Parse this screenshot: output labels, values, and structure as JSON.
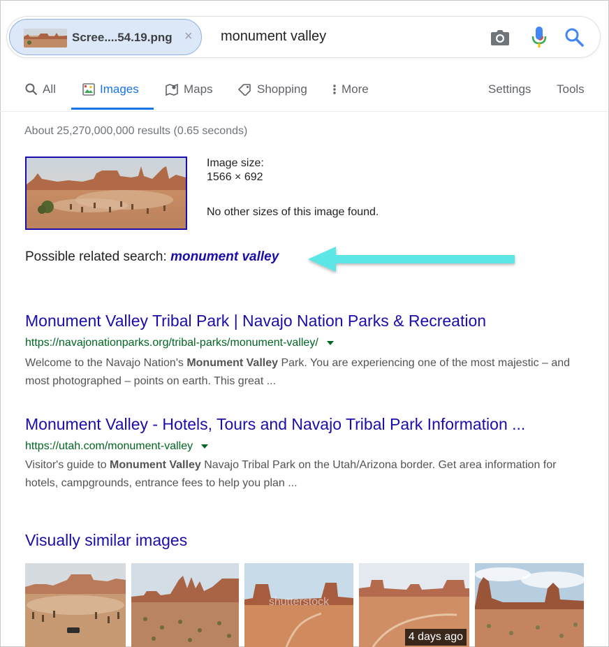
{
  "search": {
    "chip_label": "Scree....54.19.png",
    "chip_close": "×",
    "query": "monument valley",
    "icons": [
      "camera-icon",
      "microphone-icon",
      "search-icon"
    ]
  },
  "tabs": [
    {
      "label": "All",
      "icon": "search-icon"
    },
    {
      "label": "Images",
      "icon": "image-icon",
      "active": true
    },
    {
      "label": "Maps",
      "icon": "map-icon"
    },
    {
      "label": "Shopping",
      "icon": "tag-icon"
    },
    {
      "label": "More",
      "icon": "more-vert-icon"
    }
  ],
  "tools": {
    "settings": "Settings",
    "tools": "Tools"
  },
  "stats": "About 25,270,000,000 results (0.65 seconds)",
  "image_info": {
    "size_label": "Image size:",
    "size_value": "1566 × 692",
    "other_sizes": "No other sizes of this image found."
  },
  "related": {
    "prefix": "Possible related search:",
    "link": "monument valley"
  },
  "results": [
    {
      "title": "Monument Valley Tribal Park | Navajo Nation Parks & Recreation",
      "url": "https://navajonationparks.org/tribal-parks/monument-valley/",
      "snippet_1": "Welcome to the Navajo Nation's ",
      "snippet_bold": "Monument Valley",
      "snippet_2": " Park. You are experiencing one of the most majestic – and most photographed – points on earth. This great ..."
    },
    {
      "title": "Monument Valley - Hotels, Tours and Navajo Tribal Park Information ...",
      "url": "https://utah.com/monument-valley",
      "snippet_1": "Visitor's guide to ",
      "snippet_bold": "Monument Valley",
      "snippet_2": " Navajo Tribal Park on the Utah/Arizona border. Get area information for hotels, campgrounds, entrance fees to help you plan ..."
    }
  ],
  "similar": {
    "title": "Visually similar images",
    "watermark": "shutterstock",
    "badge": "4 days ago"
  },
  "colors": {
    "link": "#1a0dab",
    "url": "#006621",
    "active_tab": "#1a73e8",
    "arrow": "#5ce6e6"
  }
}
